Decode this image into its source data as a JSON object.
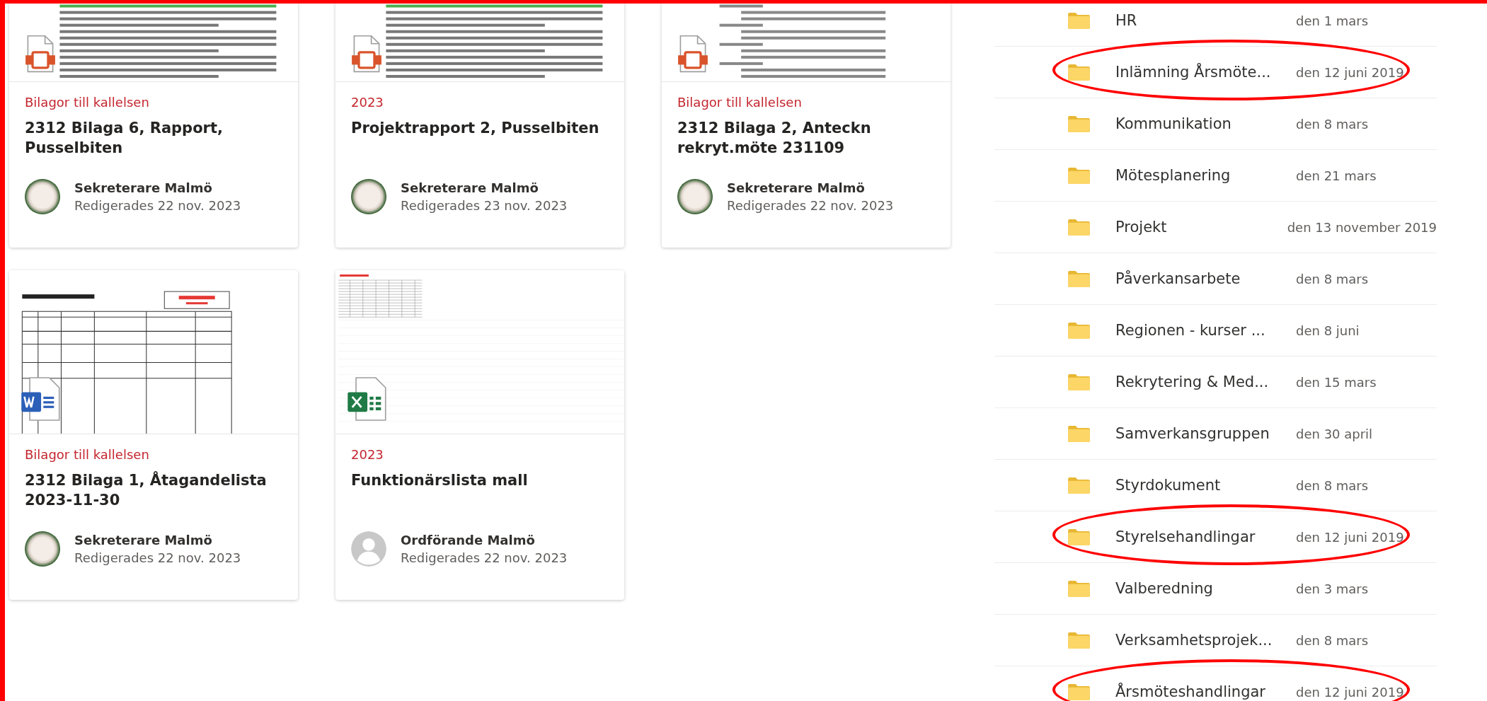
{
  "annotation_frame": true,
  "cards": [
    {
      "file_icon": {
        "kind": "pdf"
      },
      "thumbnail": {
        "kind": "text"
      },
      "category": "Bilagor till kallelsen",
      "title": "2312 Bilaga 6, Rapport, Pusselbiten",
      "author": "Sekreterare Malmö",
      "edited": "Redigerades 22 nov. 2023",
      "avatar": {
        "kind": "photo"
      }
    },
    {
      "file_icon": {
        "kind": "pdf"
      },
      "thumbnail": {
        "kind": "text"
      },
      "category": "2023",
      "title": "Projektrapport 2, Pusselbiten",
      "author": "Sekreterare Malmö",
      "edited": "Redigerades 23 nov. 2023",
      "avatar": {
        "kind": "photo"
      }
    },
    {
      "file_icon": {
        "kind": "pdf"
      },
      "thumbnail": {
        "kind": "list"
      },
      "category": "Bilagor till kallelsen",
      "title": "2312 Bilaga 2, Anteckn rekryt.möte 231109",
      "author": "Sekreterare Malmö",
      "edited": "Redigerades 22 nov. 2023",
      "avatar": {
        "kind": "photo"
      }
    },
    {
      "file_icon": {
        "kind": "word"
      },
      "thumbnail": {
        "kind": "table"
      },
      "category": "Bilagor till kallelsen",
      "title": "2312 Bilaga 1, Åtagandelista 2023-11-30",
      "author": "Sekreterare Malmö",
      "edited": "Redigerades 22 nov. 2023",
      "avatar": {
        "kind": "photo"
      }
    },
    {
      "file_icon": {
        "kind": "excel"
      },
      "thumbnail": {
        "kind": "sheet"
      },
      "category": "2023",
      "title": "Funktionärslista mall",
      "author": "Ordförande Malmö",
      "edited": "Redigerades 22 nov. 2023",
      "avatar": {
        "kind": "default"
      }
    }
  ],
  "folders": [
    {
      "name": "HR",
      "modified": "den 1 mars",
      "circled": false
    },
    {
      "name": "Inlämning Årsmöte...",
      "modified": "den 12 juni 2019",
      "circled": true
    },
    {
      "name": "Kommunikation",
      "modified": "den 8 mars",
      "circled": false
    },
    {
      "name": "Mötesplanering",
      "modified": "den 21 mars",
      "circled": false
    },
    {
      "name": "Projekt",
      "modified": "den 13 november 2019",
      "circled": false
    },
    {
      "name": "Påverkansarbete",
      "modified": "den 8 mars",
      "circled": false
    },
    {
      "name": "Regionen - kurser ...",
      "modified": "den 8 juni",
      "circled": false
    },
    {
      "name": "Rekrytering & Med...",
      "modified": "den 15 mars",
      "circled": false
    },
    {
      "name": "Samverkansgruppen",
      "modified": "den 30 april",
      "circled": false
    },
    {
      "name": "Styrdokument",
      "modified": "den 8 mars",
      "circled": false
    },
    {
      "name": "Styrelsehandlingar",
      "modified": "den 12 juni 2019",
      "circled": true
    },
    {
      "name": "Valberedning",
      "modified": "den 3 mars",
      "circled": false
    },
    {
      "name": "Verksamhetsprojek...",
      "modified": "den 8 mars",
      "circled": false
    },
    {
      "name": "Årsmöteshandlingar",
      "modified": "den 12 juni 2019",
      "circled": true
    }
  ]
}
